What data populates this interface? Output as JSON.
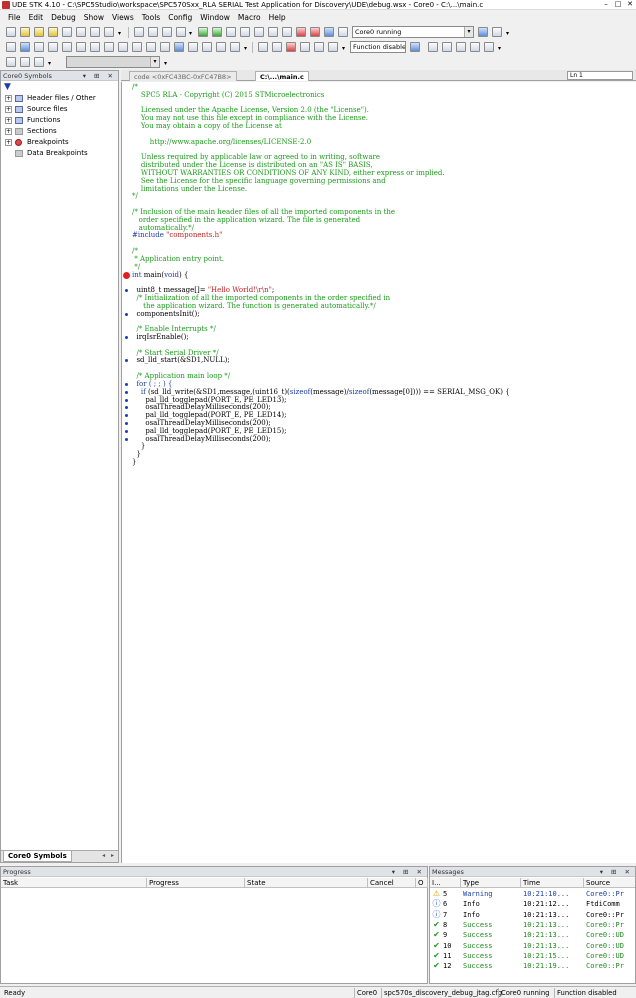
{
  "window": {
    "title": "UDE STK 4.10 - C:\\SPC5Studio\\workspace\\SPC570Sxx_RLA SERIAL Test Application for Discovery\\UDE\\debug.wsx - Core0 - C:\\...\\main.c",
    "min": "–",
    "max": "□",
    "close": "✕"
  },
  "menu": [
    "File",
    "Edit",
    "Debug",
    "Show",
    "Views",
    "Tools",
    "Config",
    "Window",
    "Macro",
    "Help"
  ],
  "toolbar": {
    "core_status": "Core0 running",
    "function_state": "Function disabled"
  },
  "left_panel": {
    "title": "Core0 Symbols",
    "tree": [
      {
        "label": "Header files / Other",
        "expander": "+"
      },
      {
        "label": "Source files",
        "expander": "+"
      },
      {
        "label": "Functions",
        "expander": "+"
      },
      {
        "label": "Sections",
        "expander": "+"
      },
      {
        "label": "Breakpoints",
        "expander": "+"
      },
      {
        "label": "Data Breakpoints",
        "expander": ""
      }
    ],
    "tab": "Core0 Symbols"
  },
  "editor": {
    "tabs": [
      "code <0xFC43BC-0xFC47B8>",
      "C:\\...\\main.c"
    ],
    "line_indicator": "Ln 1",
    "lines": [
      {
        "t": "/*",
        "c": "comment"
      },
      {
        "t": "    SPC5 RLA - Copyright (C) 2015 STMicroelectronics",
        "c": "comment"
      },
      {
        "t": "",
        "c": "plain"
      },
      {
        "t": "    Licensed under the Apache License, Version 2.0 (the \"License\").",
        "c": "comment"
      },
      {
        "t": "    You may not use this file except in compliance with the License.",
        "c": "comment"
      },
      {
        "t": "    You may obtain a copy of the License at",
        "c": "comment"
      },
      {
        "t": "",
        "c": "plain"
      },
      {
        "t": "        http://www.apache.org/licenses/LICENSE-2.0",
        "c": "comment"
      },
      {
        "t": "",
        "c": "plain"
      },
      {
        "t": "    Unless required by applicable law or agreed to in writing, software",
        "c": "comment"
      },
      {
        "t": "    distributed under the License is distributed on an \"AS IS\" BASIS,",
        "c": "comment"
      },
      {
        "t": "    WITHOUT WARRANTIES OR CONDITIONS OF ANY KIND, either express or implied.",
        "c": "comment"
      },
      {
        "t": "    See the License for the specific language governing permissions and",
        "c": "comment"
      },
      {
        "t": "    limitations under the License.",
        "c": "comment"
      },
      {
        "t": "*/",
        "c": "comment"
      },
      {
        "t": "",
        "c": "plain"
      },
      {
        "t": "/* Inclusion of the main header files of all the imported components in the",
        "c": "comment"
      },
      {
        "t": "   order specified in the application wizard. The file is generated",
        "c": "comment"
      },
      {
        "t": "   automatically.*/",
        "c": "comment"
      },
      {
        "t": "#include \"components.h\"",
        "c": "pp",
        "m": "include"
      },
      {
        "t": "",
        "c": "plain"
      },
      {
        "t": "/*",
        "c": "comment"
      },
      {
        "t": " * Application entry point.",
        "c": "comment"
      },
      {
        "t": " */",
        "c": "comment"
      },
      {
        "t": "int main(void) {",
        "c": "plain",
        "m": "main",
        "bp": true
      },
      {
        "t": "",
        "c": "plain"
      },
      {
        "t": "  uint8_t message[]= \"Hello World!\\r\\n\";",
        "c": "plain",
        "m": "msg",
        "mark": true
      },
      {
        "t": "  /* Initialization of all the imported components in the order specified in",
        "c": "comment"
      },
      {
        "t": "     the application wizard. The function is generated automatically.*/",
        "c": "comment"
      },
      {
        "t": "  componentsInit();",
        "c": "plain",
        "mark": true
      },
      {
        "t": "",
        "c": "plain"
      },
      {
        "t": "  /* Enable Interrupts */",
        "c": "comment"
      },
      {
        "t": "  irqIsrEnable();",
        "c": "plain",
        "mark": true
      },
      {
        "t": "",
        "c": "plain"
      },
      {
        "t": "  /* Start Serial Driver */",
        "c": "comment"
      },
      {
        "t": "  sd_lld_start(&SD1,NULL);",
        "c": "plain",
        "mark": true
      },
      {
        "t": "",
        "c": "plain"
      },
      {
        "t": "  /* Application main loop */",
        "c": "comment"
      },
      {
        "t": "  for ( ; ; ) {",
        "c": "kw",
        "mark": true
      },
      {
        "t": "    if (sd_lld_write(&SD1,message,(uint16_t)(sizeof(message)/sizeof(message[0]))) == SERIAL_MSG_OK) {",
        "c": "plain",
        "m": "if",
        "mark": true
      },
      {
        "t": "      pal_lld_togglepad(PORT_E, PE_LED13);",
        "c": "plain",
        "mark": true
      },
      {
        "t": "      osalThreadDelayMilliseconds(200);",
        "c": "plain",
        "mark": true
      },
      {
        "t": "      pal_lld_togglepad(PORT_E, PE_LED14);",
        "c": "plain",
        "mark": true
      },
      {
        "t": "      osalThreadDelayMilliseconds(200);",
        "c": "plain",
        "mark": true
      },
      {
        "t": "      pal_lld_togglepad(PORT_E, PE_LED15);",
        "c": "plain",
        "mark": true
      },
      {
        "t": "      osalThreadDelayMilliseconds(200);",
        "c": "plain",
        "mark": true
      },
      {
        "t": "    }",
        "c": "plain"
      },
      {
        "t": "  }",
        "c": "plain"
      },
      {
        "t": "}",
        "c": "plain"
      }
    ]
  },
  "progress_panel": {
    "title": "Progress",
    "columns": [
      "Task",
      "Progress",
      "State",
      "Cancel",
      "O"
    ]
  },
  "messages_panel": {
    "title": "Messages",
    "columns": [
      "I...",
      "Type",
      "Time",
      "Source"
    ],
    "rows": [
      {
        "icon": "warning",
        "idx": "5",
        "type": "Warning",
        "time": "10:21:10...",
        "source": "Core0::Pr",
        "color": "#1a3ea8"
      },
      {
        "icon": "info",
        "idx": "6",
        "type": "Info",
        "time": "10:21:12...",
        "source": "FtdiComm",
        "color": "#000000"
      },
      {
        "icon": "info",
        "idx": "7",
        "type": "Info",
        "time": "10:21:13...",
        "source": "Core0::Pr",
        "color": "#000000"
      },
      {
        "icon": "success",
        "idx": "8",
        "type": "Success",
        "time": "10:21:13...",
        "source": "Core0::Pr",
        "color": "#1e8a1e"
      },
      {
        "icon": "success",
        "idx": "9",
        "type": "Success",
        "time": "10:21:13...",
        "source": "Core0::UD",
        "color": "#1e8a1e"
      },
      {
        "icon": "success",
        "idx": "10",
        "type": "Success",
        "time": "10:21:13...",
        "source": "Core0::UD",
        "color": "#1e8a1e"
      },
      {
        "icon": "success",
        "idx": "11",
        "type": "Success",
        "time": "10:21:15...",
        "source": "Core0::UD",
        "color": "#1e8a1e"
      },
      {
        "icon": "success",
        "idx": "12",
        "type": "Success",
        "time": "10:21:19...",
        "source": "Core0::Pr",
        "color": "#1e8a1e"
      }
    ]
  },
  "statusbar": {
    "ready": "Ready",
    "core": "Core0",
    "config": "spc570s_discovery_debug_jtag.cfg",
    "run_state": "Core0 running",
    "function_state": "Function disabled"
  }
}
